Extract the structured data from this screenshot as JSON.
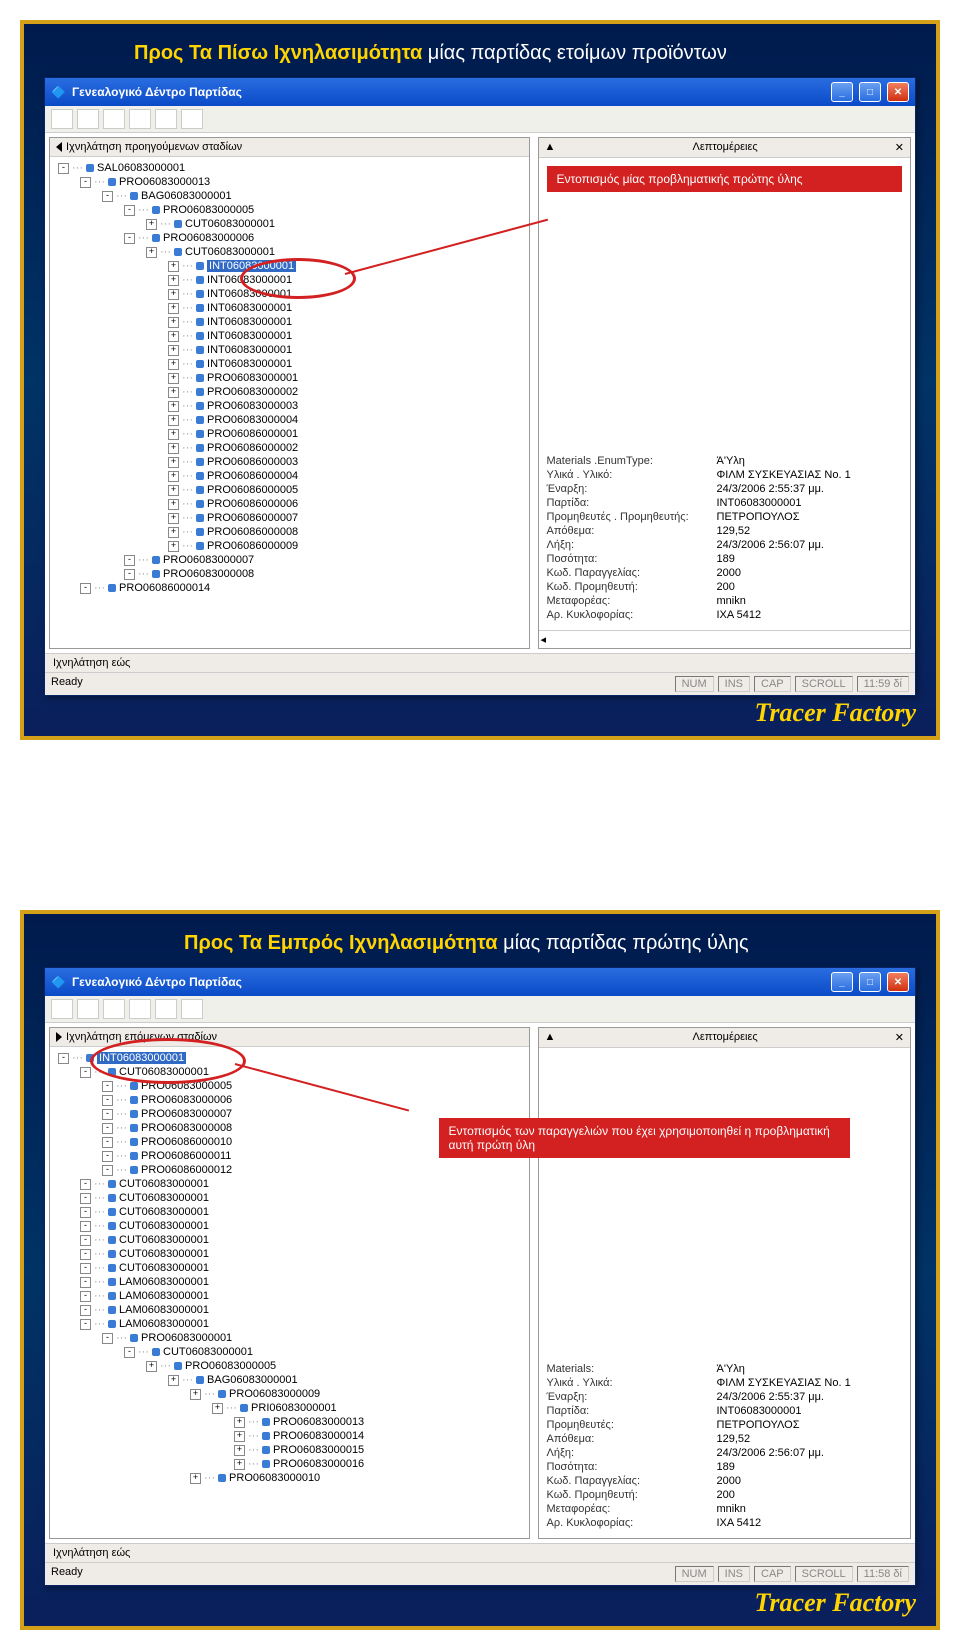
{
  "slide1": {
    "title_bold": "Προς Τα Πίσω Ιχνηλασιμότητα",
    "title_rest": " μίας παρτίδας ετοίμων προϊόντων",
    "window_title": "Γενεαλογικό Δέντρο Παρτίδας",
    "tree_header": "Ιχνηλάτηση προηγούμενων σταδίων",
    "detail_header": "Λεπτομέρειες",
    "callout": "Εντοπισμός μίας προβληματικής πρώτης ύλης",
    "footer_tab": "Ιχνηλάτηση εώς",
    "status_ready": "Ready",
    "status_time": "11:59 δί",
    "selected_node": "INT06083000001",
    "tree": [
      "SAL06083000001",
      " PRO06083000013",
      "  BAG06083000001",
      "   PRO06083000005",
      "    CUT06083000001",
      "   PRO06083000006",
      "    CUT06083000001",
      "     INT06083000001",
      "     INT06083000001",
      "     INT06083000001",
      "     INT06083000001",
      "     INT06083000001",
      "     INT06083000001",
      "     INT06083000001",
      "     INT06083000001",
      "     PRO06083000001",
      "     PRO06083000002",
      "     PRO06083000003",
      "     PRO06083000004",
      "     PRO06086000001",
      "     PRO06086000002",
      "     PRO06086000003",
      "     PRO06086000004",
      "     PRO06086000005",
      "     PRO06086000006",
      "     PRO06086000007",
      "     PRO06086000008",
      "     PRO06086000009",
      "   PRO06083000007",
      "   PRO06083000008",
      " PRO06086000014"
    ],
    "props": [
      {
        "k": "Materials .EnumType:",
        "v": "Ά'Υλη"
      },
      {
        "k": "Υλικά . Υλικό:",
        "v": "ΦΙΛΜ ΣΥΣΚΕΥΑΣΙΑΣ Νο. 1"
      },
      {
        "k": "Έναρξη:",
        "v": "24/3/2006 2:55:37 μμ."
      },
      {
        "k": "Παρτίδα:",
        "v": "INT06083000001"
      },
      {
        "k": "Προμηθευτές . Προμηθευτής:",
        "v": "ΠΕΤΡΟΠΟΥΛΟΣ"
      },
      {
        "k": "Απόθεμα:",
        "v": "129,52"
      },
      {
        "k": "Λήξη:",
        "v": "24/3/2006 2:56:07 μμ."
      },
      {
        "k": "Ποσότητα:",
        "v": "189"
      },
      {
        "k": "Κωδ. Παραγγελίας:",
        "v": "2000"
      },
      {
        "k": "Κωδ. Προμηθευτή:",
        "v": "200"
      },
      {
        "k": "Μεταφορέας:",
        "v": "mnikn"
      },
      {
        "k": "Αρ. Κυκλοφορίας:",
        "v": "ΙΧΑ 5412"
      }
    ]
  },
  "slide2": {
    "title_bold": "Προς Τα Εμπρός Ιχνηλασιμότητα",
    "title_rest": " μίας παρτίδας πρώτης ύλης",
    "window_title": "Γενεαλογικό Δέντρο Παρτίδας",
    "tree_header": "Ιχνηλάτηση επόμενων σταδίων",
    "detail_header": "Λεπτομέρειες",
    "callout": "Εντοπισμός των παραγγελιών που έχει χρησιμοποιηθεί η προβληματική αυτή πρώτη ύλη",
    "footer_tab": "Ιχνηλάτηση εώς",
    "status_ready": "Ready",
    "status_time": "11:58 δί",
    "selected_node": "INT06083000001",
    "tree": [
      "INT06083000001",
      " CUT06083000001",
      "  PRO06083000005",
      "  PRO06083000006",
      "  PRO06083000007",
      "  PRO06083000008",
      "  PRO06086000010",
      "  PRO06086000011",
      "  PRO06086000012",
      " CUT06083000001",
      " CUT06083000001",
      " CUT06083000001",
      " CUT06083000001",
      " CUT06083000001",
      " CUT06083000001",
      " CUT06083000001",
      " LAM06083000001",
      " LAM06083000001",
      " LAM06083000001",
      " LAM06083000001",
      "  PRO06083000001",
      "   CUT06083000001",
      "    PRO06083000005",
      "     BAG06083000001",
      "      PRO06083000009",
      "       PRI06083000001",
      "        PRO06083000013",
      "        PRO06083000014",
      "        PRO06083000015",
      "        PRO06083000016",
      "      PRO06083000010"
    ],
    "props": [
      {
        "k": "Materials:",
        "v": "Ά'Υλη"
      },
      {
        "k": "Υλικά . Υλικά:",
        "v": "ΦΙΛΜ ΣΥΣΚΕΥΑΣΙΑΣ Νο. 1"
      },
      {
        "k": "Έναρξη:",
        "v": "24/3/2006 2:55:37 μμ."
      },
      {
        "k": "Παρτίδα:",
        "v": "INT06083000001"
      },
      {
        "k": "Προμηθευτές:",
        "v": "ΠΕΤΡΟΠΟΥΛΟΣ"
      },
      {
        "k": "Απόθεμα:",
        "v": "129,52"
      },
      {
        "k": "Λήξη:",
        "v": "24/3/2006 2:56:07 μμ."
      },
      {
        "k": "Ποσότητα:",
        "v": "189"
      },
      {
        "k": "Κωδ. Παραγγελίας:",
        "v": "2000"
      },
      {
        "k": "Κωδ. Προμηθευτή:",
        "v": "200"
      },
      {
        "k": "Μεταφορέας:",
        "v": "mnikn"
      },
      {
        "k": "Αρ. Κυκλοφορίας:",
        "v": "ΙΧΑ 5412"
      }
    ]
  },
  "status_labels": {
    "num": "NUM",
    "ins": "INS",
    "cap": "CAP",
    "scroll": "SCROLL"
  },
  "brand": "Tracer Factory"
}
